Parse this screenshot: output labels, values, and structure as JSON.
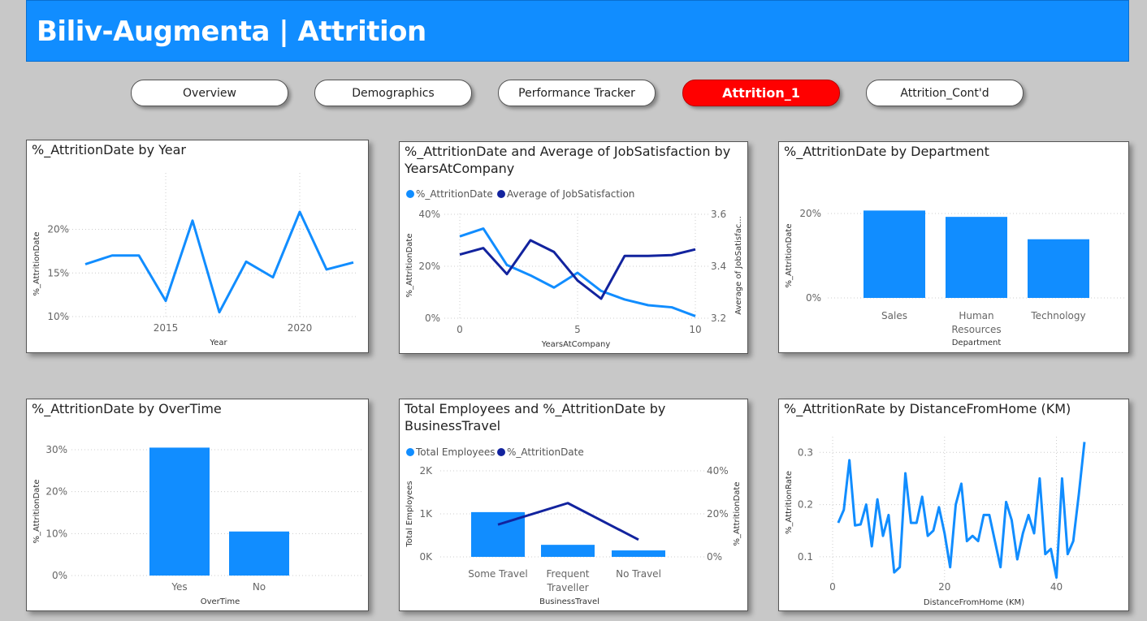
{
  "header": {
    "title": "Biliv-Augmenta | Attrition"
  },
  "nav": {
    "tabs": [
      {
        "label": "Overview"
      },
      {
        "label": "Demographics"
      },
      {
        "label": "Performance Tracker"
      },
      {
        "label": "Attrition_1"
      },
      {
        "label": "Attrition_Cont'd"
      }
    ],
    "active_index": 3
  },
  "colors": {
    "accent": "#118dff",
    "dark": "#12239e",
    "active_tab": "#ff0000",
    "background": "#c8c8c8"
  },
  "chart_data": [
    {
      "id": "by_year",
      "type": "line",
      "title": "%_AttritionDate by Year",
      "xlabel": "Year",
      "ylabel": "%_AttritionDate",
      "x": [
        2012,
        2013,
        2014,
        2015,
        2016,
        2017,
        2018,
        2019,
        2020,
        2021,
        2022
      ],
      "series": [
        {
          "values": [
            16.0,
            17.0,
            17.0,
            11.8,
            21.0,
            10.5,
            16.3,
            14.5,
            22.0,
            15.4,
            16.2
          ]
        }
      ],
      "ylim": [
        10,
        22
      ],
      "yticks": [
        "10%",
        "15%",
        "20%"
      ],
      "ytick_values": [
        10,
        15,
        20
      ],
      "xticks": [
        "2015",
        "2020"
      ],
      "xtick_values": [
        2015,
        2020
      ]
    },
    {
      "id": "by_years_at_company",
      "type": "line",
      "title": "%_AttritionDate and Average of JobSatisfaction by YearsAtCompany",
      "xlabel": "YearsAtCompany",
      "ylabel": "%_AttritionDate",
      "y2label": "Average of JobSatisfac...",
      "legend": [
        "%_AttritionDate",
        "Average of JobSatisfaction"
      ],
      "x": [
        0,
        1,
        2,
        3,
        4,
        5,
        6,
        7,
        8,
        9,
        10
      ],
      "series": [
        {
          "name": "%_AttritionDate",
          "axis": "left",
          "values": [
            31.5,
            34.5,
            20.5,
            16.5,
            11.8,
            17.5,
            10.5,
            7.2,
            5.0,
            4.2,
            0.8
          ]
        },
        {
          "name": "Average of JobSatisfaction",
          "axis": "right",
          "values": [
            3.445,
            3.47,
            3.37,
            3.5,
            3.455,
            3.345,
            3.275,
            3.44,
            3.44,
            3.443,
            3.465
          ]
        }
      ],
      "ylim": [
        0,
        40
      ],
      "y2lim": [
        3.2,
        3.6
      ],
      "yticks": [
        "0%",
        "20%",
        "40%"
      ],
      "ytick_values": [
        0,
        20,
        40
      ],
      "y2ticks": [
        "3.2",
        "3.4",
        "3.6"
      ],
      "y2tick_values": [
        3.2,
        3.4,
        3.6
      ],
      "xticks": [
        "0",
        "5",
        "10"
      ],
      "xtick_values": [
        0,
        5,
        10
      ]
    },
    {
      "id": "by_department",
      "type": "bar",
      "title": "%_AttritionDate by Department",
      "xlabel": "Department",
      "ylabel": "%_AttritionDate",
      "categories": [
        "Sales",
        "Human Resources",
        "Technology"
      ],
      "category_lines": [
        [
          "Sales"
        ],
        [
          "Human",
          "Resources"
        ],
        [
          "Technology"
        ]
      ],
      "values": [
        20.7,
        19.2,
        13.9
      ],
      "ylim": [
        0,
        20
      ],
      "yticks": [
        "0%",
        "20%"
      ],
      "ytick_values": [
        0,
        20
      ]
    },
    {
      "id": "by_overtime",
      "type": "bar",
      "title": "%_AttritionDate by OverTime",
      "xlabel": "OverTime",
      "ylabel": "%_AttritionDate",
      "categories": [
        "Yes",
        "No"
      ],
      "category_lines": [
        [
          "Yes"
        ],
        [
          "No"
        ]
      ],
      "values": [
        30.5,
        10.5
      ],
      "ylim": [
        0,
        30
      ],
      "yticks": [
        "0%",
        "10%",
        "20%",
        "30%"
      ],
      "ytick_values": [
        0,
        10,
        20,
        30
      ]
    },
    {
      "id": "by_business_travel",
      "type": "bar",
      "title": "Total Employees and %_AttritionDate by BusinessTravel",
      "xlabel": "BusinessTravel",
      "ylabel": "Total Employees",
      "y2label": "%_AttritionDate",
      "legend": [
        "Total Employees",
        "%_AttritionDate"
      ],
      "categories": [
        "Some Travel",
        "Frequent Traveller",
        "No Travel"
      ],
      "category_lines": [
        [
          "Some Travel"
        ],
        [
          "Frequent",
          "Traveller"
        ],
        [
          "No Travel"
        ]
      ],
      "series": [
        {
          "name": "Total Employees",
          "kind": "bar",
          "axis": "left",
          "values": [
            1040,
            280,
            150
          ]
        },
        {
          "name": "%_AttritionDate",
          "kind": "line",
          "axis": "right",
          "values": [
            15.0,
            25.0,
            8.0
          ]
        }
      ],
      "ylim": [
        0,
        2000
      ],
      "y2lim": [
        0,
        40
      ],
      "yticks": [
        "0K",
        "1K",
        "2K"
      ],
      "ytick_values": [
        0,
        1000,
        2000
      ],
      "y2ticks": [
        "0%",
        "20%",
        "40%"
      ],
      "y2tick_values": [
        0,
        20,
        40
      ]
    },
    {
      "id": "by_distance",
      "type": "line",
      "title": "%_AttritionRate by DistanceFromHome (KM)",
      "xlabel": "DistanceFromHome (KM)",
      "ylabel": "%_AttritionRate",
      "x": [
        1,
        2,
        3,
        4,
        5,
        6,
        7,
        8,
        9,
        10,
        11,
        12,
        13,
        14,
        15,
        16,
        17,
        18,
        19,
        20,
        21,
        22,
        23,
        24,
        25,
        26,
        27,
        28,
        29,
        30,
        31,
        32,
        33,
        34,
        35,
        36,
        37,
        38,
        39,
        40,
        41,
        42,
        43,
        44,
        45
      ],
      "series": [
        {
          "values": [
            0.165,
            0.19,
            0.285,
            0.16,
            0.162,
            0.2,
            0.12,
            0.21,
            0.14,
            0.18,
            0.07,
            0.08,
            0.26,
            0.165,
            0.165,
            0.215,
            0.14,
            0.15,
            0.195,
            0.145,
            0.08,
            0.2,
            0.24,
            0.13,
            0.14,
            0.13,
            0.18,
            0.18,
            0.13,
            0.08,
            0.205,
            0.17,
            0.095,
            0.145,
            0.18,
            0.145,
            0.25,
            0.105,
            0.115,
            0.06,
            0.25,
            0.105,
            0.13,
            0.22,
            0.32
          ]
        }
      ],
      "ylim": [
        0.05,
        0.33
      ],
      "yticks": [
        "0.1",
        "0.2",
        "0.3"
      ],
      "ytick_values": [
        0.1,
        0.2,
        0.3
      ],
      "xlim": [
        0,
        45
      ],
      "xticks": [
        "0",
        "20",
        "40"
      ],
      "xtick_values": [
        0,
        20,
        40
      ]
    }
  ]
}
